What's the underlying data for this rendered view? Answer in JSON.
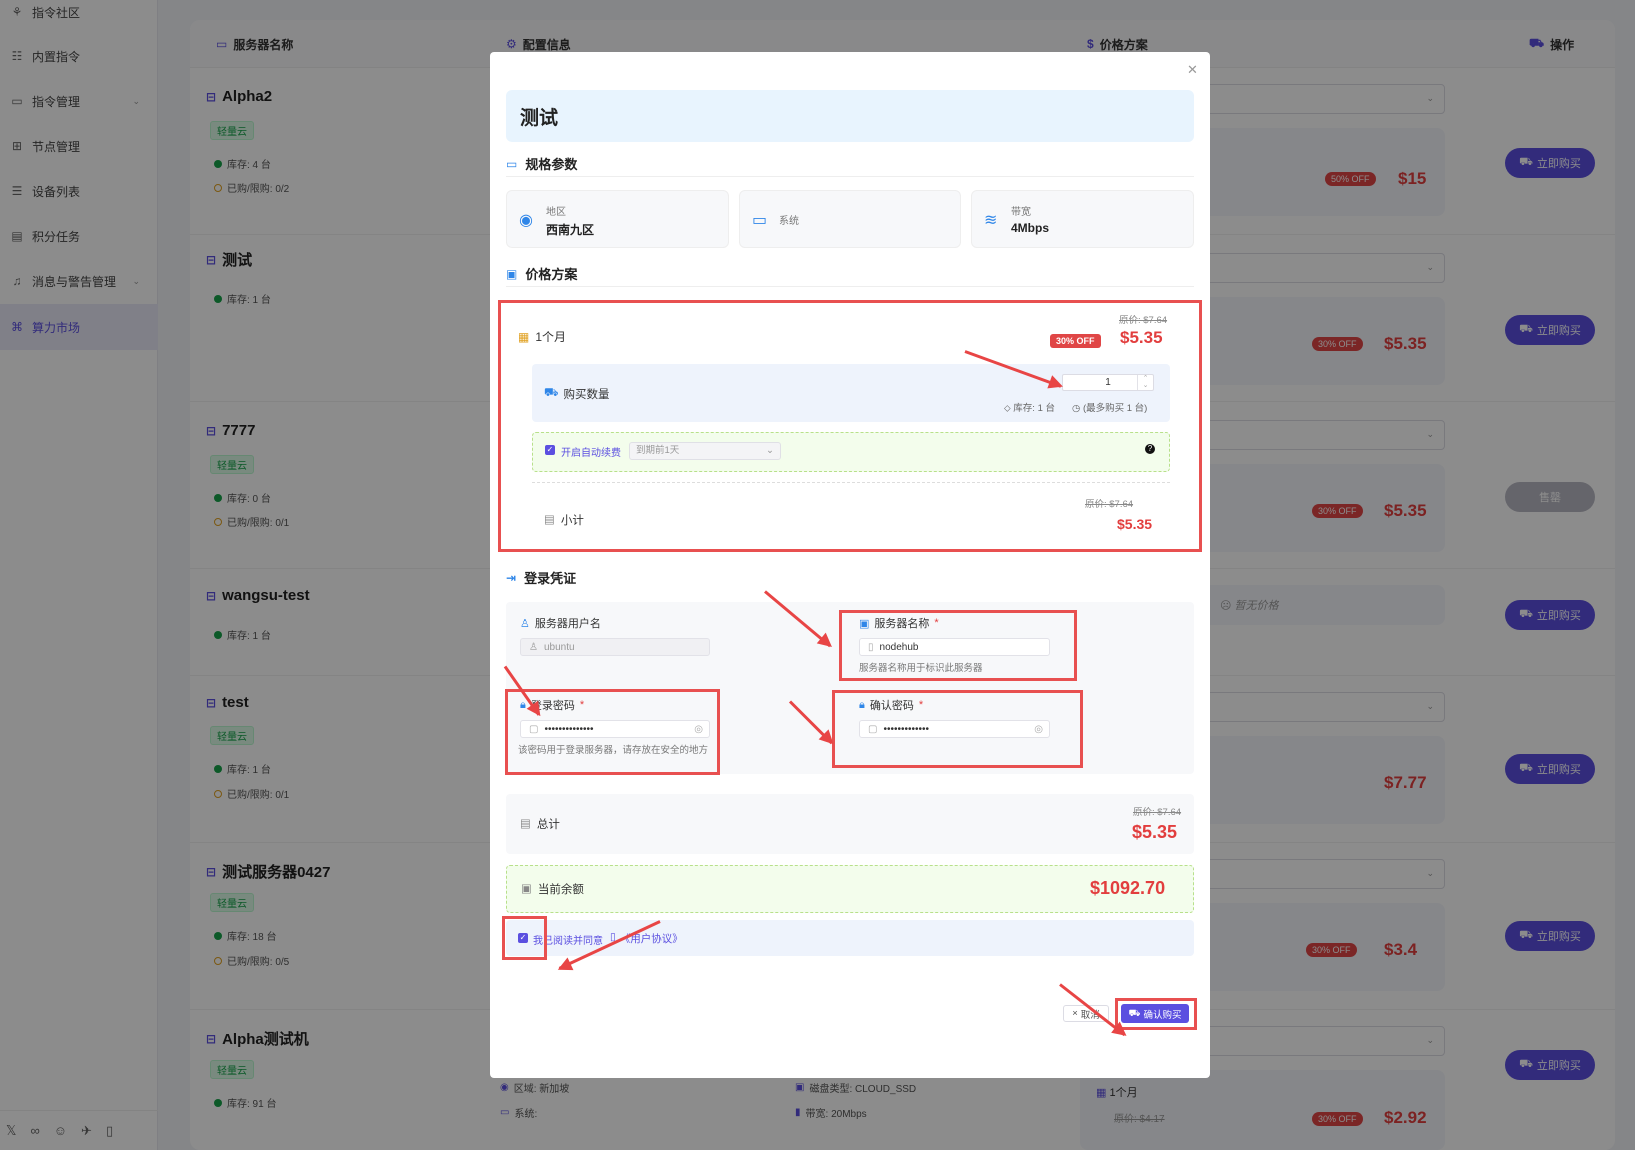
{
  "sidebar": {
    "items": [
      {
        "label": "指令社区",
        "icon": "community-icon"
      },
      {
        "label": "内置指令",
        "icon": "builtin-command-icon"
      },
      {
        "label": "指令管理",
        "icon": "command-manage-icon",
        "expandable": true
      },
      {
        "label": "节点管理",
        "icon": "node-icon"
      },
      {
        "label": "设备列表",
        "icon": "device-list-icon"
      },
      {
        "label": "积分任务",
        "icon": "points-task-icon"
      },
      {
        "label": "消息与警告管理",
        "icon": "bell-icon",
        "expandable": true
      },
      {
        "label": "算力市场",
        "icon": "market-icon",
        "active": true
      }
    ],
    "footer_icons": [
      "x-icon",
      "link-icon",
      "discord-icon",
      "telegram-icon",
      "doc-icon"
    ]
  },
  "table": {
    "headers": {
      "name": "服务器名称",
      "config": "配置信息",
      "price": "价格方案",
      "action": "操作"
    },
    "rows": [
      {
        "name": "Alpha2",
        "tag": "轻量云",
        "stock": "库存: 4 台",
        "limit": "已购/限购: 0/2",
        "off": "50% OFF",
        "price": "$15",
        "button": "立即购买"
      },
      {
        "name": "测试",
        "tag": "",
        "stock": "库存: 1 台",
        "limit": "",
        "off": "30% OFF",
        "price": "$5.35",
        "button": "立即购买"
      },
      {
        "name": "7777",
        "tag": "轻量云",
        "stock": "库存: 0 台",
        "limit": "已购/限购: 0/1",
        "off": "30% OFF",
        "price": "$5.35",
        "button": "售罄"
      },
      {
        "name": "wangsu-test",
        "tag": "",
        "stock": "库存: 1 台",
        "limit": "",
        "no_price": "暂无价格",
        "button": "立即购买"
      },
      {
        "name": "test",
        "tag": "轻量云",
        "stock": "库存: 1 台",
        "limit": "已购/限购: 0/1",
        "price": "$7.77",
        "button": "立即购买"
      },
      {
        "name": "测试服务器0427",
        "tag": "轻量云",
        "stock": "库存: 18 台",
        "limit": "已购/限购: 0/5",
        "off": "30% OFF",
        "price": "$3.4",
        "button": "立即购买"
      },
      {
        "name": "Alpha测试机",
        "tag": "轻量云",
        "stock": "库存: 91 台",
        "limit": "",
        "off": "30% OFF",
        "price": "$2.92",
        "original": "原价: $4.17",
        "period": "1个月",
        "region": "区域: 新加坡",
        "system": "系统:",
        "disk": "磁盘类型: CLOUD_SSD",
        "bandwidth": "带宽: 20Mbps",
        "button": "立即购买"
      }
    ]
  },
  "modal": {
    "title": "测试",
    "spec_section": "规格参数",
    "specs": [
      {
        "label": "地区",
        "value": "西南九区",
        "icon": "location-icon"
      },
      {
        "label": "系统",
        "value": "",
        "icon": "monitor-icon"
      },
      {
        "label": "带宽",
        "value": "4Mbps",
        "icon": "wifi-icon"
      }
    ],
    "price_section": "价格方案",
    "plan": {
      "period": "1个月",
      "original": "原价: $7.64",
      "off": "30% OFF",
      "price": "$5.35",
      "quantity_label": "购买数量",
      "quantity": "1",
      "stock": "库存: 1 台",
      "max": "(最多购买 1 台)",
      "auto_renew_label": "开启自动续费",
      "auto_renew_option": "到期前1天",
      "subtotal_label": "小计",
      "subtotal_original": "原价: $7.64",
      "subtotal": "$5.35"
    },
    "login_section": "登录凭证",
    "username_label": "服务器用户名",
    "username_placeholder": "ubuntu",
    "server_name_label": "服务器名称",
    "server_name_value": "nodehub",
    "server_name_hint": "服务器名称用于标识此服务器",
    "password_label": "登录密码",
    "password_value": "••••••••••••••",
    "password_hint": "该密码用于登录服务器，请存放在安全的地方",
    "confirm_password_label": "确认密码",
    "confirm_password_value": "•••••••••••••",
    "total_label": "总计",
    "total_original": "原价: $7.64",
    "total": "$5.35",
    "balance_label": "当前余额",
    "balance": "$1092.70",
    "agree_text": "我已阅读并同意",
    "agreement_link": "《用户协议》",
    "cancel": "取消",
    "confirm": "确认购买"
  },
  "colors": {
    "accent": "#5b4fe0",
    "price_red": "#e23e3e",
    "annotation_red": "#e85050",
    "info_blue": "#2f86e8"
  }
}
